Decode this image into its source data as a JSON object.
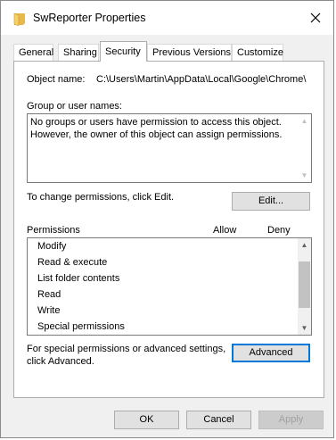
{
  "window": {
    "title": "SwReporter Properties",
    "icon": "folder-icon"
  },
  "tabs": [
    {
      "label": "General",
      "active": false
    },
    {
      "label": "Sharing",
      "active": false
    },
    {
      "label": "Security",
      "active": true
    },
    {
      "label": "Previous Versions",
      "active": false
    },
    {
      "label": "Customize",
      "active": false
    }
  ],
  "security": {
    "object_name_label": "Object name:",
    "object_name_value": "C:\\Users\\Martin\\AppData\\Local\\Google\\Chrome\\",
    "groups_label": "Group or user names:",
    "groups_message_line1": "No groups or users have permission to access this object.",
    "groups_message_line2": "However, the owner of this object can assign permissions.",
    "change_hint": "To change permissions, click Edit.",
    "edit_button": "Edit...",
    "permissions_label": "Permissions",
    "allow_label": "Allow",
    "deny_label": "Deny",
    "permissions": [
      "Modify",
      "Read & execute",
      "List folder contents",
      "Read",
      "Write",
      "Special permissions"
    ],
    "advanced_hint_line1": "For special permissions or advanced settings,",
    "advanced_hint_line2": "click Advanced.",
    "advanced_button": "Advanced"
  },
  "footer": {
    "ok": "OK",
    "cancel": "Cancel",
    "apply": "Apply"
  }
}
